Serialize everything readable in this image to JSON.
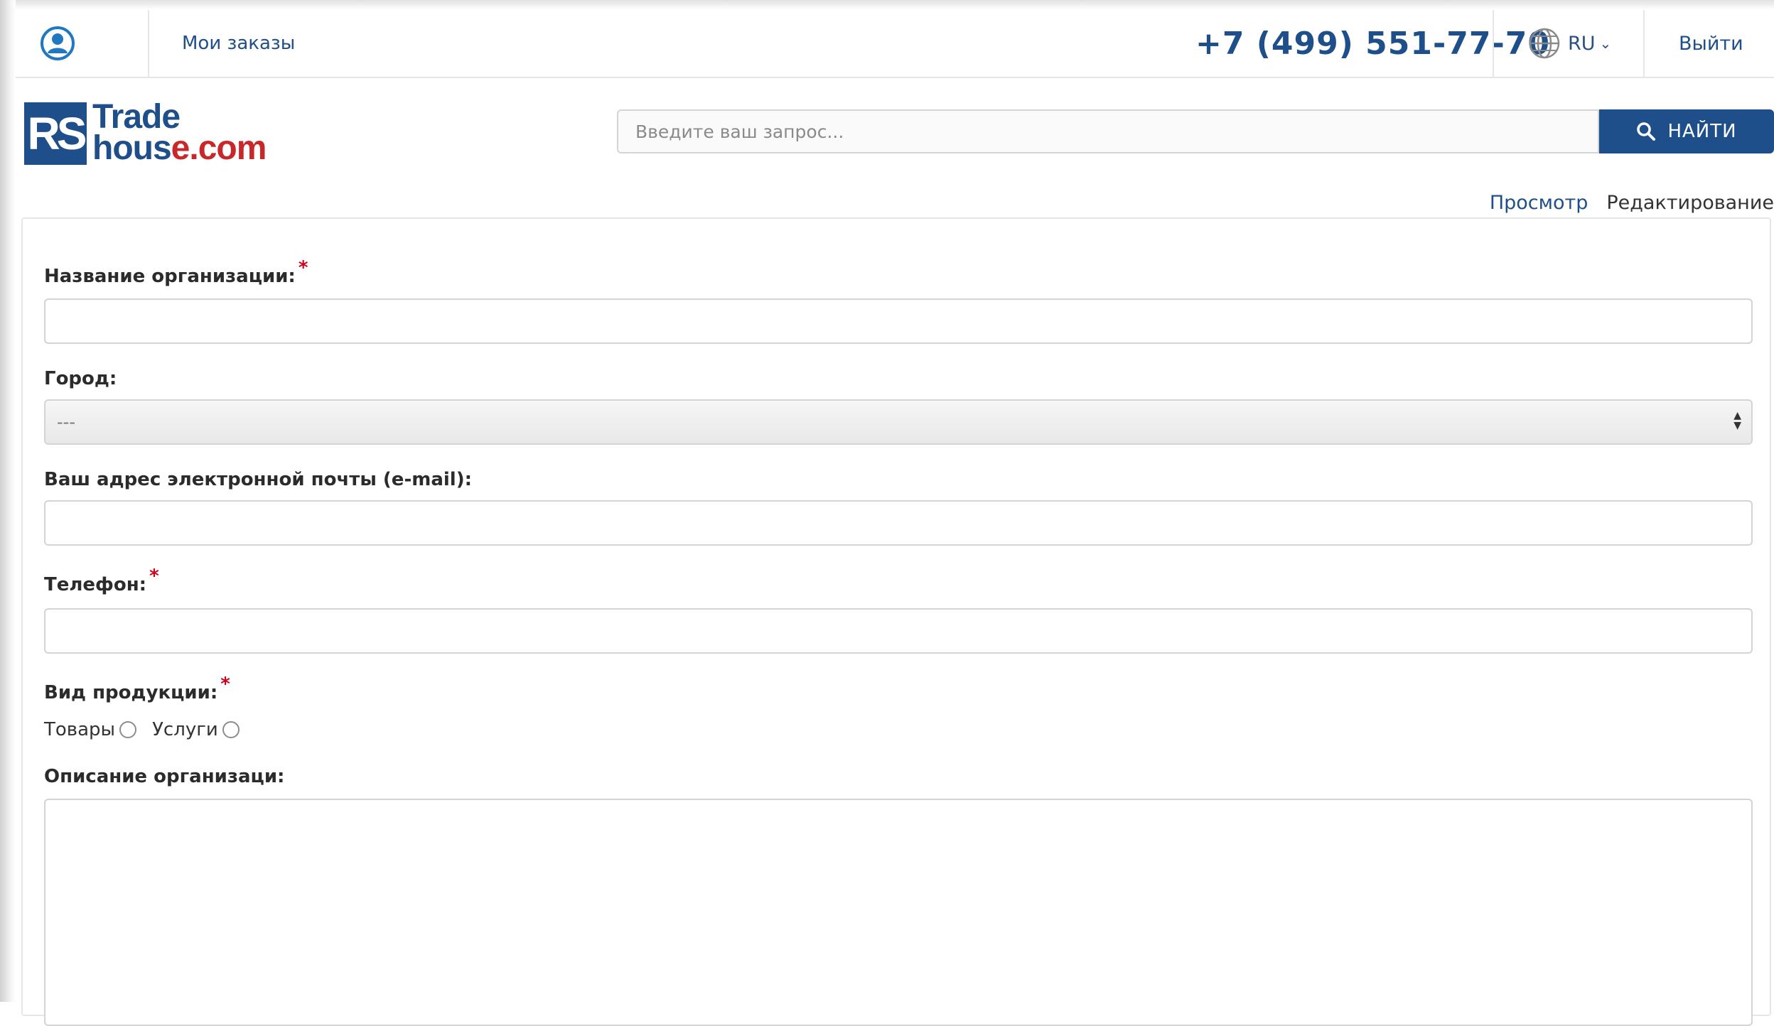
{
  "topbar": {
    "my_orders": "Мои заказы",
    "phone": "+7 (499) 551-77-70",
    "lang": "RU",
    "logout": "Выйти"
  },
  "logo": {
    "mark": "RS",
    "line1": "Trade",
    "line2_blue": "hous",
    "line2_red": "e.com"
  },
  "search": {
    "placeholder": "Введите ваш запрос...",
    "button_label": "НАЙТИ"
  },
  "tabs": {
    "view": "Просмотр",
    "edit": "Редактирование"
  },
  "form": {
    "org_name_label": "Название организации:",
    "city_label": "Город:",
    "city_value": "---",
    "email_label": "Ваш адрес электронной почты (e-mail):",
    "phone_label": "Телефон:",
    "product_type_label": "Вид продукции:",
    "option_goods": "Товары",
    "option_services": "Услуги",
    "description_label": "Описание организаци:",
    "required_mark": "*"
  },
  "colors": {
    "brand_blue": "#1f4f8b",
    "brand_red": "#c8282a",
    "required_red": "#d0021b"
  },
  "icons": [
    "user-icon",
    "globe-icon",
    "chevron-down-icon",
    "search-icon"
  ]
}
